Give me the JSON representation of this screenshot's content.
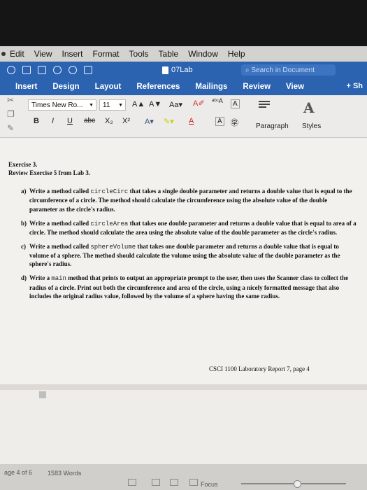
{
  "menu": {
    "items": [
      "Edit",
      "View",
      "Insert",
      "Format",
      "Tools",
      "Table",
      "Window",
      "Help"
    ]
  },
  "titlebar": {
    "doc_title": "07Lab",
    "search_placeholder": "Search in Document"
  },
  "ribbon_tabs": [
    "Insert",
    "Design",
    "Layout",
    "References",
    "Mailings",
    "Review",
    "View"
  ],
  "share_label": "Sh",
  "ribbon": {
    "font_name": "Times New Ro...",
    "font_size": "11",
    "paragraph_label": "Paragraph",
    "styles_label": "Styles"
  },
  "document": {
    "exercise_title": "Exercise 3.",
    "exercise_subtitle": "Review Exercise 5 from Lab 3.",
    "items": [
      {
        "label": "a)",
        "pre": "Write a method called ",
        "code": "circleCirc",
        "post": " that takes a single double parameter and returns a double value that is equal to the circumference of a circle. The method should calculate the circumference using the absolute value of the double parameter as the circle's radius."
      },
      {
        "label": "b)",
        "pre": "Write a method called ",
        "code": "circleArea",
        "post": " that takes one double parameter and returns a double value that is equal to area of a circle. The method should calculate the area using the absolute value of the double parameter as the circle's radius."
      },
      {
        "label": "c)",
        "pre": "Write a method called ",
        "code": "sphereVolume",
        "post": " that takes one double parameter and returns a double value that is equal to volume of a sphere. The method should calculate the volume using the absolute value of the double parameter as the sphere's radius."
      },
      {
        "label": "d)",
        "pre": "Write a ",
        "code": "main",
        "post": " method that prints to output an appropriate prompt to the user, then uses the Scanner class to collect the radius of a circle. Print out both the circumference and area of the circle, using a nicely formatted message that also includes the original radius value, followed by the volume of a sphere having the same radius."
      }
    ],
    "footer": "CSCI 1100 Laboratory Report 7, page 4"
  },
  "status": {
    "pages": "age 4 of 6",
    "words": "1583 Words",
    "focus": "Focus"
  }
}
